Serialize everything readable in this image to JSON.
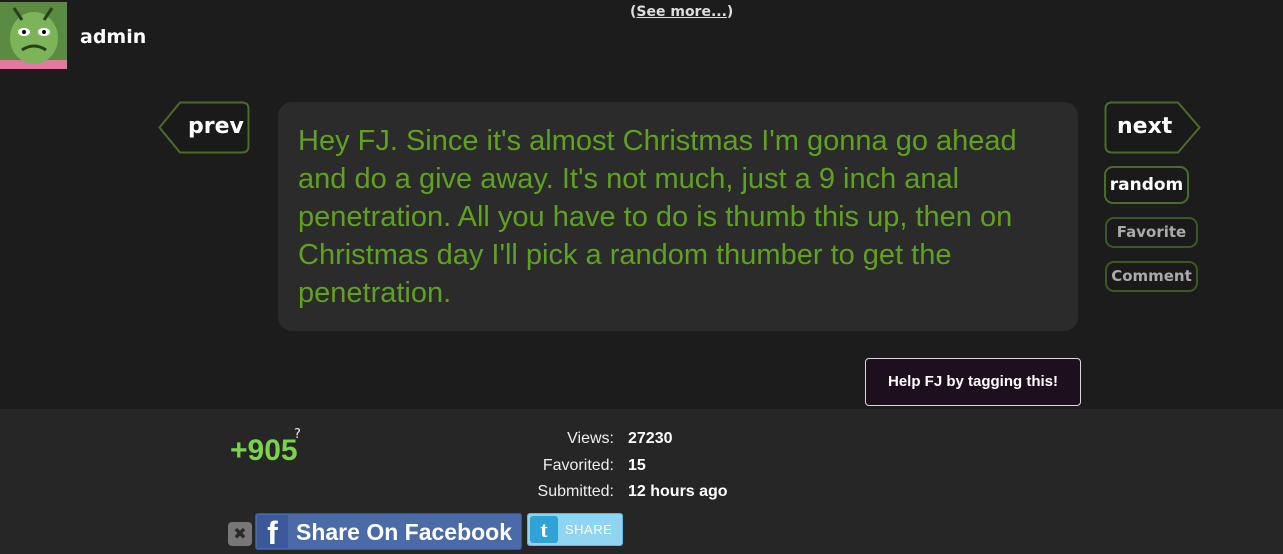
{
  "user": {
    "name": "admin"
  },
  "header": {
    "see_more_open": "(",
    "see_more_link": "See more...",
    "see_more_close": ")"
  },
  "nav": {
    "prev": "prev",
    "next": "next",
    "random": "random",
    "favorite": "Favorite",
    "comment": "Comment"
  },
  "post": {
    "text": "Hey FJ. Since it's almost Christmas I'm gonna go ahead and do a give away. It's not much, just a 9 inch anal penetration. All you have to do is thumb this up, then on Christmas day I'll pick a random thumber to get the penetration."
  },
  "tag_button": "Help FJ by tagging this!",
  "stats": {
    "score": "+905",
    "score_help": "?",
    "views_label": "Views:",
    "views": "27230",
    "favorited_label": "Favorited:",
    "favorited": "15",
    "submitted_label": "Submitted:",
    "submitted": "12 hours ago"
  },
  "share": {
    "close": "✖",
    "facebook_icon": "f",
    "facebook_label": "Share On Facebook",
    "twitter_icon": "t",
    "twitter_label": "SHARE"
  },
  "colors": {
    "accent_green": "#5fa121",
    "score_green": "#7bd24d",
    "border_green": "#3b5a20",
    "facebook_blue": "#4a6ba8",
    "twitter_blue": "#8fd4f0"
  }
}
